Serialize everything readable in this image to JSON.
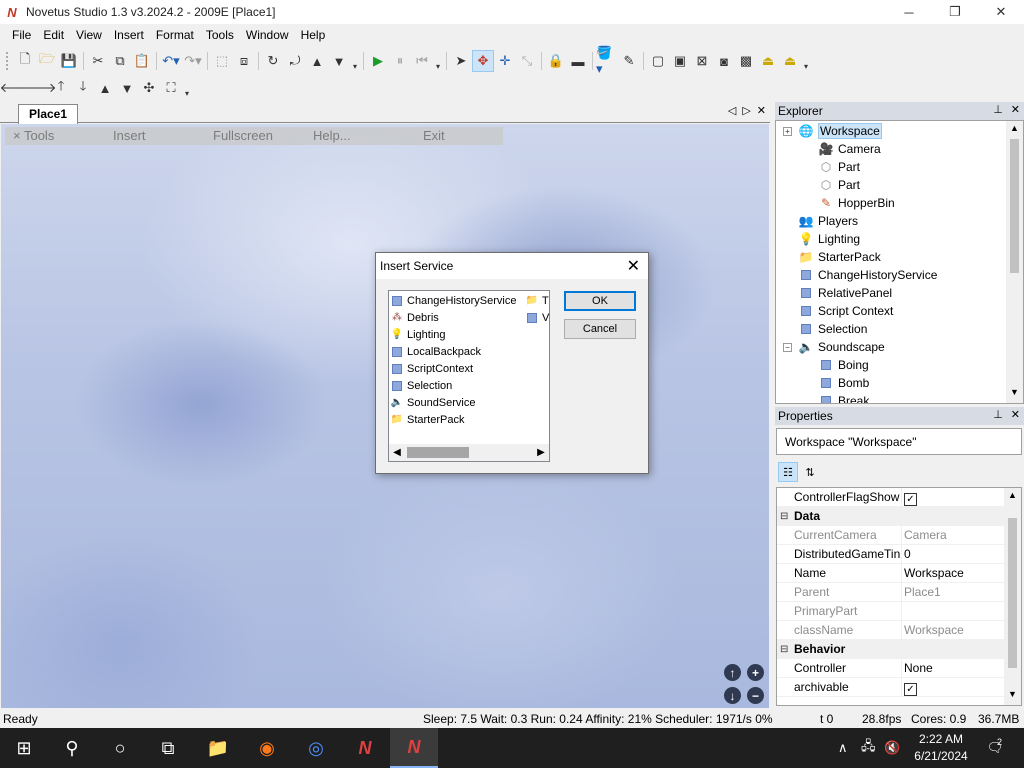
{
  "window": {
    "title": "Novetus Studio 1.3 v3.2024.2 - 2009E [Place1]",
    "app_icon": "N",
    "minimize": "─",
    "maximize": "❐",
    "close": "✕"
  },
  "menu": [
    "File",
    "Edit",
    "View",
    "Insert",
    "Format",
    "Tools",
    "Window",
    "Help"
  ],
  "document": {
    "tab_label": "Place1",
    "tab_prev": "◁",
    "tab_next": "▷",
    "tab_close": "✕"
  },
  "ingame_menu": {
    "tools": "× Tools",
    "insert": "Insert",
    "fullscreen": "Fullscreen",
    "help": "Help...",
    "exit": "Exit"
  },
  "camera_controls": {
    "up": "↑",
    "zoom_in": "+",
    "down": "↓",
    "zoom_out": "−"
  },
  "dialog": {
    "title": "Insert Service",
    "close": "✕",
    "services": [
      {
        "name": "ChangeHistoryService",
        "icon": "square-icon"
      },
      {
        "name": "Debris",
        "icon": "debris-icon"
      },
      {
        "name": "Lighting",
        "icon": "lightbulb-icon"
      },
      {
        "name": "LocalBackpack",
        "icon": "square-icon"
      },
      {
        "name": "ScriptContext",
        "icon": "square-icon"
      },
      {
        "name": "Selection",
        "icon": "square-icon"
      },
      {
        "name": "SoundService",
        "icon": "speaker-icon"
      },
      {
        "name": "StarterPack",
        "icon": "folder-icon"
      }
    ],
    "second_column": [
      {
        "name": "T",
        "icon": "folder-icon"
      },
      {
        "name": "V",
        "icon": "square-icon"
      }
    ],
    "ok_label": "OK",
    "cancel_label": "Cancel"
  },
  "explorer": {
    "title": "Explorer",
    "pin": "📌",
    "close": "✕",
    "items": [
      {
        "label": "Workspace",
        "icon": "globe-icon",
        "level": 0,
        "expander": "+",
        "selected": true
      },
      {
        "label": "Camera",
        "icon": "camera-icon",
        "level": 1
      },
      {
        "label": "Part",
        "icon": "part-icon",
        "level": 1
      },
      {
        "label": "Part",
        "icon": "part-icon",
        "level": 1
      },
      {
        "label": "HopperBin",
        "icon": "hopperbin-icon",
        "level": 1
      },
      {
        "label": "Players",
        "icon": "players-icon",
        "level": 0
      },
      {
        "label": "Lighting",
        "icon": "lightbulb-icon",
        "level": 0
      },
      {
        "label": "StarterPack",
        "icon": "folder-icon",
        "level": 0
      },
      {
        "label": "ChangeHistoryService",
        "icon": "square-icon",
        "level": 0
      },
      {
        "label": "RelativePanel",
        "icon": "square-icon",
        "level": 0
      },
      {
        "label": "Script Context",
        "icon": "square-icon",
        "level": 0
      },
      {
        "label": "Selection",
        "icon": "square-icon",
        "level": 0
      },
      {
        "label": "Soundscape",
        "icon": "speaker-icon",
        "level": 0,
        "expander": "−"
      },
      {
        "label": "Boing",
        "icon": "square-icon",
        "level": 1
      },
      {
        "label": "Bomb",
        "icon": "square-icon",
        "level": 1
      },
      {
        "label": "Break",
        "icon": "square-icon",
        "level": 1
      }
    ]
  },
  "properties": {
    "title": "Properties",
    "pin": "📌",
    "close": "✕",
    "object_label": "Workspace \"Workspace\"",
    "rows": [
      {
        "name": "ControllerFlagShow",
        "value": "",
        "check": true,
        "type": "prop"
      },
      {
        "name": "Data",
        "type": "cat"
      },
      {
        "name": "CurrentCamera",
        "value": "Camera",
        "type": "ro"
      },
      {
        "name": "DistributedGameTin",
        "value": "0",
        "type": "prop"
      },
      {
        "name": "Name",
        "value": "Workspace",
        "type": "prop"
      },
      {
        "name": "Parent",
        "value": "Place1",
        "type": "ro"
      },
      {
        "name": "PrimaryPart",
        "value": "",
        "type": "ro"
      },
      {
        "name": "className",
        "value": "Workspace",
        "type": "ro"
      },
      {
        "name": "Behavior",
        "type": "cat"
      },
      {
        "name": "Controller",
        "value": "None",
        "type": "prop"
      },
      {
        "name": "archivable",
        "value": "",
        "check": true,
        "type": "prop"
      }
    ]
  },
  "status": {
    "ready": "Ready",
    "perf": "Sleep: 7.5 Wait: 0.3 Run: 0.24 Affinity: 21% Scheduler: 1971/s 0%",
    "t": "t 0",
    "fps": "28.8fps",
    "cores": "Cores: 0.9",
    "mem": "36.7MB"
  },
  "taskbar": {
    "time": "2:22 AM",
    "date": "6/21/2024",
    "notif_count": "2"
  },
  "colors": {
    "accent": "#0078d7",
    "selection": "#cce4f7",
    "taskbar": "#1f1f1f"
  }
}
